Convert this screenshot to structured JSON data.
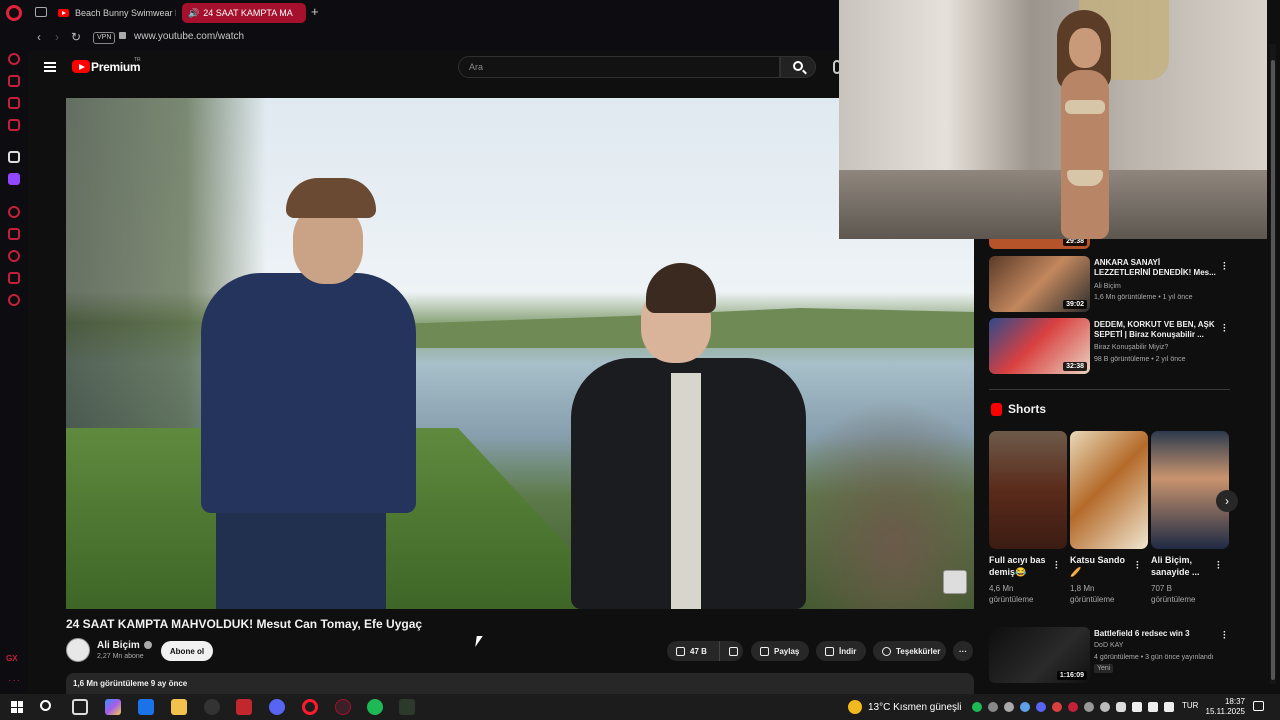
{
  "browser": {
    "tabs": [
      {
        "label": "Beach Bunny Swimwear F"
      },
      {
        "label": "24 SAAT KAMPTA MA"
      }
    ],
    "new_tab": "+",
    "vpn": "VPN",
    "url": "www.youtube.com/watch"
  },
  "youtube": {
    "logo": "Premium",
    "logo_region": "TR",
    "search_placeholder": "Ara"
  },
  "video": {
    "title": "24 SAAT KAMPTA MAHVOLDUK! Mesut Can Tomay, Efe Uygaç",
    "channel": "Ali Biçim",
    "subscribers": "2,27 Mn abone",
    "subscribe_label": "Abone ol",
    "likes": "47 B",
    "share_label": "Paylaş",
    "download_label": "İndir",
    "thanks_label": "Teşekkürler",
    "views_meta": "1,6 Mn görüntüleme  9 ay önce"
  },
  "related": [
    {
      "title": "",
      "duration": "29:38"
    },
    {
      "title": "ANKARA SANAYİ LEZZETLERİNİ DENEDİK! Mes...",
      "channel": "Ali Biçim",
      "meta": "1,6 Mn görüntüleme • 1 yıl önce",
      "duration": "39:02"
    },
    {
      "title": "DEDEM, KORKUT VE BEN, AŞK SEPETİ | Biraz Konuşabilir ...",
      "channel": "Biraz Konuşabilir Miyiz?",
      "meta": "98 B görüntüleme • 2 yıl önce",
      "duration": "32:38"
    },
    {
      "title": "Battlefield 6 redsec win 3",
      "channel": "DoD KAY",
      "meta": "4 görüntüleme • 3 gün önce yayınlandı",
      "badge": "Yeni",
      "duration": "1:16:09"
    }
  ],
  "shorts": {
    "heading": "Shorts",
    "items": [
      {
        "title": "Full acıyı bas demiş😂",
        "views": "4,6 Mn görüntüleme"
      },
      {
        "title": "Katsu Sando 🥖",
        "views": "1,8 Mn görüntüleme"
      },
      {
        "title": "Ali Biçim, sanayide ...",
        "views": "707 B görüntüleme"
      }
    ]
  },
  "taskbar": {
    "weather": "13°C  Kısmen güneşli",
    "lang": "TUR",
    "time": "18:37",
    "date": "15.11.2025"
  },
  "colors": {
    "accent": "#ff0000",
    "opera_red": "#c4203a",
    "active_tab": "#a5102c",
    "background": "#0f0f0f"
  }
}
